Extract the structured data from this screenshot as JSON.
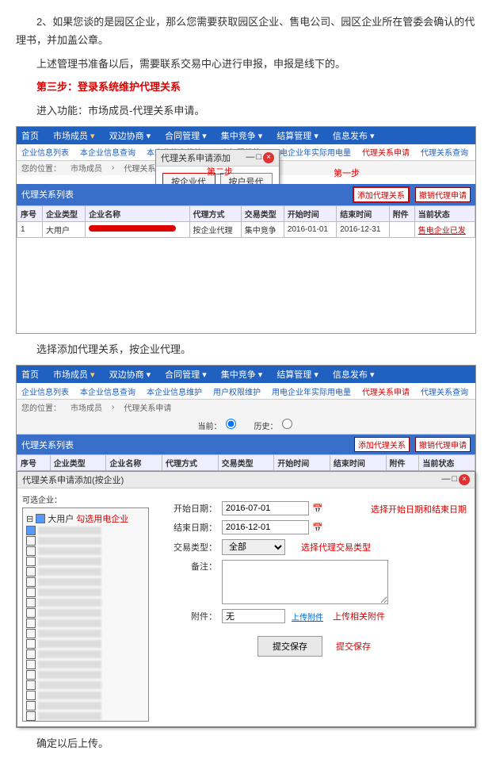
{
  "doc": {
    "para1": "2、如果您谈的是园区企业，那么您需要获取园区企业、售电公司、园区企业所在管委会确认的代理书，并加盖公章。",
    "para2": "上述管理书准备以后，需要联系交易中心进行申报，申报是线下的。",
    "step3": "第三步：登录系统维护代理关系",
    "para3": "进入功能：市场成员-代理关系申请。",
    "para4": "选择添加代理关系，按企业代理。",
    "para5": "确定以后上传。"
  },
  "shot1": {
    "menu": {
      "home": "首页",
      "active": "市场成员",
      "m1": "双边协商",
      "m2": "合同管理",
      "m3": "集中竞争",
      "m4": "结算管理",
      "m5": "信息发布"
    },
    "sub": {
      "s1": "企业信息列表",
      "s2": "本企业信息查询",
      "s3": "本企业信息维护",
      "s4": "用户权限维护",
      "s5": "用电企业年实际用电量",
      "s6": "代理关系申请",
      "s7": "代理关系查询"
    },
    "crumb": {
      "c1": "您的位置：",
      "c2": "市场成员",
      "c3": "代理关系申请"
    },
    "popup": {
      "title": "代理关系申请添加",
      "btn1": "按企业代理",
      "btn2": "按户号代理"
    },
    "annot1": "第一步",
    "annot2": "第二步",
    "listTitle": "代理关系列表",
    "btnAdd": "添加代理关系",
    "btnRevoke": "撤销代理申请",
    "cols": {
      "c1": "序号",
      "c2": "企业类型",
      "c3": "企业名称",
      "c4": "代理方式",
      "c5": "交易类型",
      "c6": "开始时间",
      "c7": "结束时间",
      "c8": "附件",
      "c9": "当前状态"
    },
    "row": {
      "no": "1",
      "type": "大用户",
      "mode": "按企业代理",
      "trade": "集中竞争",
      "start": "2016-01-01",
      "end": "2016-12-31",
      "status": "售电企业已发"
    }
  },
  "shot2": {
    "radio1": "当前：",
    "radio2": "历史：",
    "popTitle": "代理关系申请添加(按企业)",
    "treeTitle": "可选企业：",
    "treeFirst": "大用户",
    "annotSel": "勾选用电企业",
    "fStart": "开始日期：",
    "vStart": "2016-07-01",
    "fEnd": "结束日期：",
    "vEnd": "2016-12-01",
    "annotDate": "选择开始日期和结束日期",
    "fType": "交易类型：",
    "vType": "全部",
    "annotType": "选择代理交易类型",
    "fRemark": "备注：",
    "fAttach": "附件：",
    "vAttach": "无",
    "linkUp": "上传附件",
    "annotAttach": "上传相关附件",
    "btnSubmit": "提交保存",
    "annotSubmit": "提交保存"
  }
}
